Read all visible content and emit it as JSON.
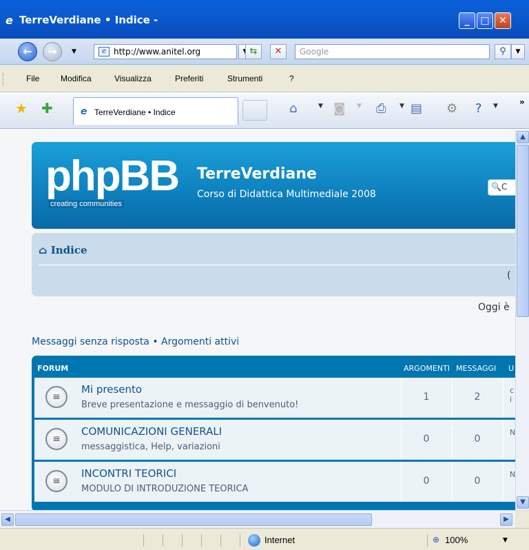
{
  "window": {
    "title": "TerreVerdiane • Indice -"
  },
  "address": {
    "url": "http://www.anitel.org",
    "search_placeholder": "Google"
  },
  "menu": [
    "File",
    "Modifica",
    "Visualizza",
    "Preferiti",
    "Strumenti",
    "?"
  ],
  "tab": {
    "label": "TerreVerdiane • Indice"
  },
  "site": {
    "logo_text": "phpBB",
    "logo_tagline": "creating  communities",
    "name": "TerreVerdiane",
    "description": "Corso di Didattica Multimediale 2008",
    "search_stub": "🔍C"
  },
  "nav": {
    "breadcrumb": "⌂ Indice",
    "right_stub": "("
  },
  "today_stub": "Oggi è",
  "links": "Messaggi senza risposta • Argomenti attivi",
  "forum": {
    "header": "FORUM",
    "col_topics": "ARGOMENTI",
    "col_posts": "MESSAGGI",
    "col_last": "U",
    "rows": [
      {
        "title": "Mi presento",
        "desc": "Breve presentazione e messaggio di benvenuto!",
        "topics": "1",
        "posts": "2",
        "last": "c\ni"
      },
      {
        "title": "COMUNICAZIONI GENERALI",
        "desc": "messaggistica, Help, variazioni",
        "topics": "0",
        "posts": "0",
        "last": "N"
      },
      {
        "title": "INCONTRI TEORICI",
        "desc": "MODULO DI INTRODUZIONE TEORICA",
        "topics": "0",
        "posts": "0",
        "last": "N"
      }
    ]
  },
  "status": {
    "zone": "Internet",
    "zoom": "100%"
  }
}
